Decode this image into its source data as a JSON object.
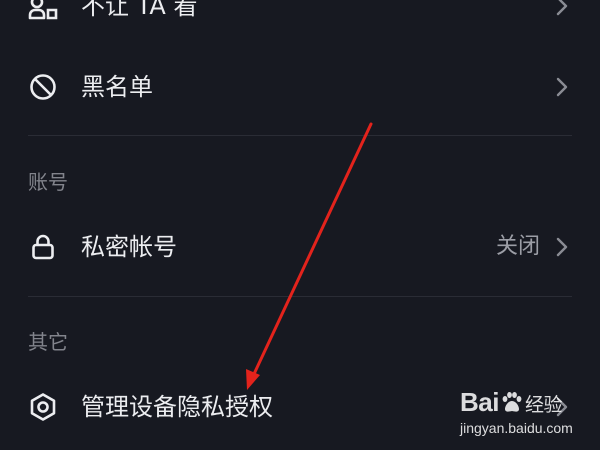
{
  "settings": {
    "rows": {
      "hide_from": {
        "label": "不让 TA 看",
        "icon": "user-block-icon"
      },
      "blacklist": {
        "label": "黑名单",
        "icon": "prohibited-icon"
      },
      "private_account": {
        "label": "私密帐号",
        "value": "关闭",
        "icon": "lock-icon"
      },
      "device_privacy": {
        "label": "管理设备隐私授权",
        "icon": "hexagon-settings-icon"
      }
    },
    "sections": {
      "account": "账号",
      "other": "其它"
    }
  },
  "colors": {
    "background": "#171921",
    "text_primary": "#ecedf0",
    "text_secondary": "#82848c",
    "value_text": "#9c9ea6",
    "divider": "#2a2c35",
    "annotation_arrow": "#e3231c"
  },
  "watermark": {
    "brand": "Baidu",
    "title": "经验",
    "url": "jingyan.baidu.com"
  }
}
